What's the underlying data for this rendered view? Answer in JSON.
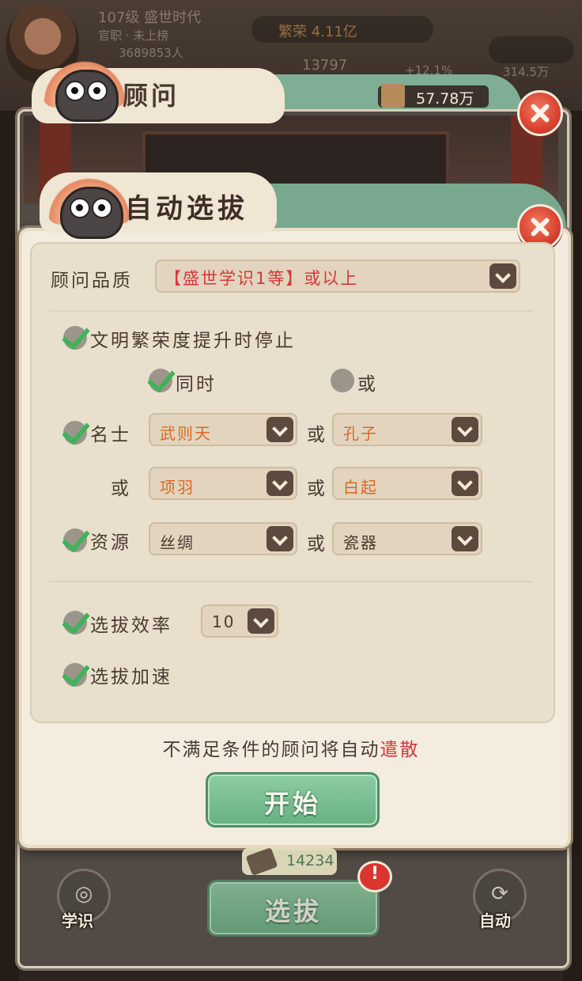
{
  "background": {
    "player_level": "107级 盛世时代",
    "player_sub": "官职 · 未上榜",
    "player_power": "3689853人",
    "stat_main": "繁荣 4.11亿",
    "stat_one": "13797",
    "stat_two": "+12.1%",
    "stat_three": "314.5万"
  },
  "outer_panel": {
    "title": "顾问",
    "balance": "57.78万"
  },
  "dialog": {
    "title": "自动选拔",
    "quality": {
      "label": "顾问品质",
      "value_bracket": "【盛世学识1等】",
      "value_suffix": "或以上"
    },
    "stop_condition": {
      "label": "文明繁荣度提升时停止",
      "checked": true,
      "mode_and": "同时",
      "mode_or": "或",
      "selected_mode": "同时"
    },
    "celebrity": {
      "label": "名士",
      "checked": true,
      "or": "或",
      "slot_1": "武则天",
      "slot_2": "孔子",
      "slot_3": "项羽",
      "slot_4": "白起"
    },
    "resource": {
      "label": "资源",
      "checked": true,
      "or": "或",
      "slot_1": "丝绸",
      "slot_2": "瓷器"
    },
    "efficiency": {
      "label": "选拔效率",
      "checked": true,
      "value": "10"
    },
    "speedup": {
      "label": "选拔加速",
      "checked": true
    },
    "note_prefix": "不满足条件的顾问将自动",
    "note_highlight": "遣散",
    "start_button": "开始"
  },
  "bottom_bar": {
    "count": "14234",
    "select_button": "选拔",
    "alert_mark": "!",
    "left_label": "学识",
    "right_label": "自动"
  },
  "colors": {
    "accent_green": "#66b182",
    "warning_red": "#d8363b",
    "name_orange": "#d96a1f",
    "panel_cream": "#f3ecdf"
  }
}
